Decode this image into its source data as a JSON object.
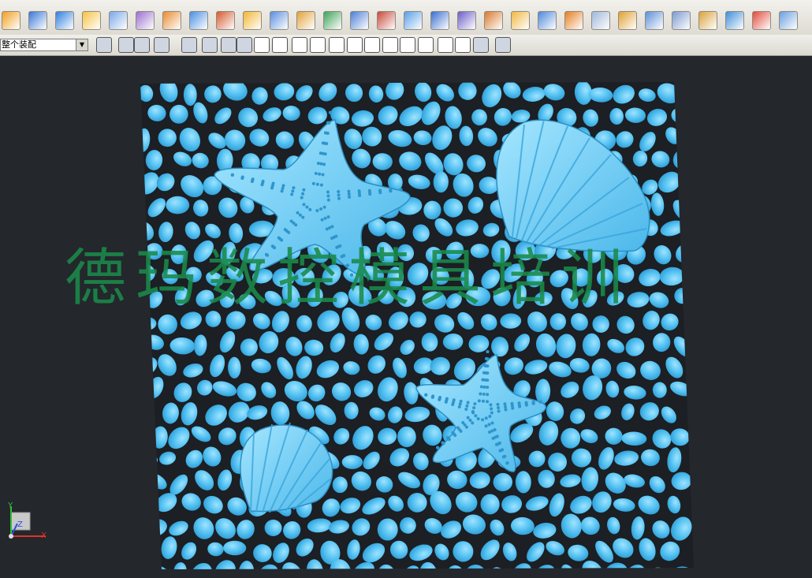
{
  "toolbar": {
    "row1_icons": [
      "assembly-icon",
      "component-icon",
      "block-icon",
      "face-icon",
      "shade-icon",
      "layer-icon",
      "cylinder-icon",
      "sketch-icon",
      "bounded-plane-icon",
      "mesh-icon",
      "sweep-icon",
      "pattern-icon",
      "transform-icon",
      "datum-icon",
      "split-icon",
      "trim-icon",
      "book-icon",
      "library-icon",
      "stack-icon",
      "cube-icon",
      "box-icon",
      "export-icon",
      "fold-icon",
      "render-icon",
      "plane-icon",
      "tube-icon",
      "extrude-icon",
      "chamfer-icon",
      "shell-icon",
      "window-icon"
    ],
    "row2_icons": [
      "filter-icon",
      "measure-icon",
      "snap-icon",
      "select-icon",
      "dropdown-icon",
      "box-select-icon",
      "view-icon",
      "solid-icon",
      "points-icon",
      "nodes-icon",
      "line-icon",
      "diagonal-icon",
      "curve-icon",
      "spline-icon",
      "angle-icon",
      "circle-point-icon",
      "target-icon",
      "plus-icon",
      "slash-icon",
      "pen-icon",
      "grid-icon",
      "stop-icon"
    ]
  },
  "assembly_select": {
    "value": "整个装配"
  },
  "viewport": {
    "watermark_text": "德玛数控模具培训",
    "background_color": "#24272c",
    "relief_color": "#5ec8f5",
    "axis_y": "Y",
    "axis_x": "X",
    "axis_z": "Z"
  }
}
